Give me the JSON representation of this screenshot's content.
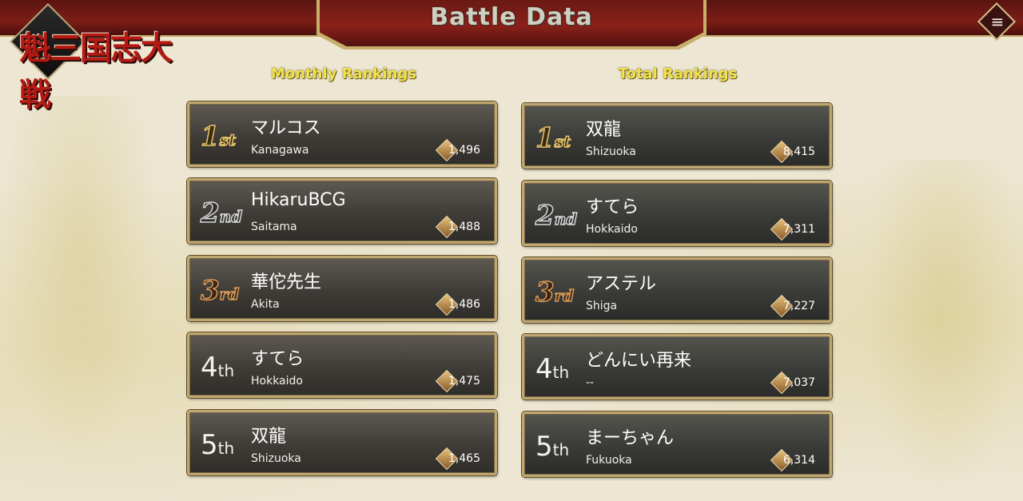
{
  "header": {
    "title": "Battle Data",
    "menu_icon": "≡"
  },
  "logo": {
    "text": "魁三国志大戦"
  },
  "monthly": {
    "heading": "Monthly Rankings",
    "entries": [
      {
        "rank_num": "1",
        "rank_suf": "st",
        "name": "マルコス",
        "prefecture": "Kanagawa",
        "score": "1,496"
      },
      {
        "rank_num": "2",
        "rank_suf": "nd",
        "name": "HikaruBCG",
        "prefecture": "Saitama",
        "score": "1,488"
      },
      {
        "rank_num": "3",
        "rank_suf": "rd",
        "name": "華佗先生",
        "prefecture": "Akita",
        "score": "1,486"
      },
      {
        "rank_num": "4",
        "rank_suf": "th",
        "name": "すてら",
        "prefecture": "Hokkaido",
        "score": "1,475"
      },
      {
        "rank_num": "5",
        "rank_suf": "th",
        "name": "双龍",
        "prefecture": "Shizuoka",
        "score": "1,465"
      }
    ]
  },
  "total": {
    "heading": "Total Rankings",
    "entries": [
      {
        "rank_num": "1",
        "rank_suf": "st",
        "name": "双龍",
        "prefecture": "Shizuoka",
        "score": "8,415"
      },
      {
        "rank_num": "2",
        "rank_suf": "nd",
        "name": "すてら",
        "prefecture": "Hokkaido",
        "score": "7,311"
      },
      {
        "rank_num": "3",
        "rank_suf": "rd",
        "name": "アステル",
        "prefecture": "Shiga",
        "score": "7,227"
      },
      {
        "rank_num": "4",
        "rank_suf": "th",
        "name": "どんにい再来",
        "prefecture": "--",
        "score": "7,037"
      },
      {
        "rank_num": "5",
        "rank_suf": "th",
        "name": "まーちゃん",
        "prefecture": "Fukuoka",
        "score": "6,314"
      }
    ]
  },
  "icons": {
    "score": "score-badge-icon",
    "menu": "menu-icon"
  },
  "colors": {
    "header_red": "#7c1d17",
    "heading_yellow": "#f2e24a",
    "card_border": "#bfa772"
  }
}
